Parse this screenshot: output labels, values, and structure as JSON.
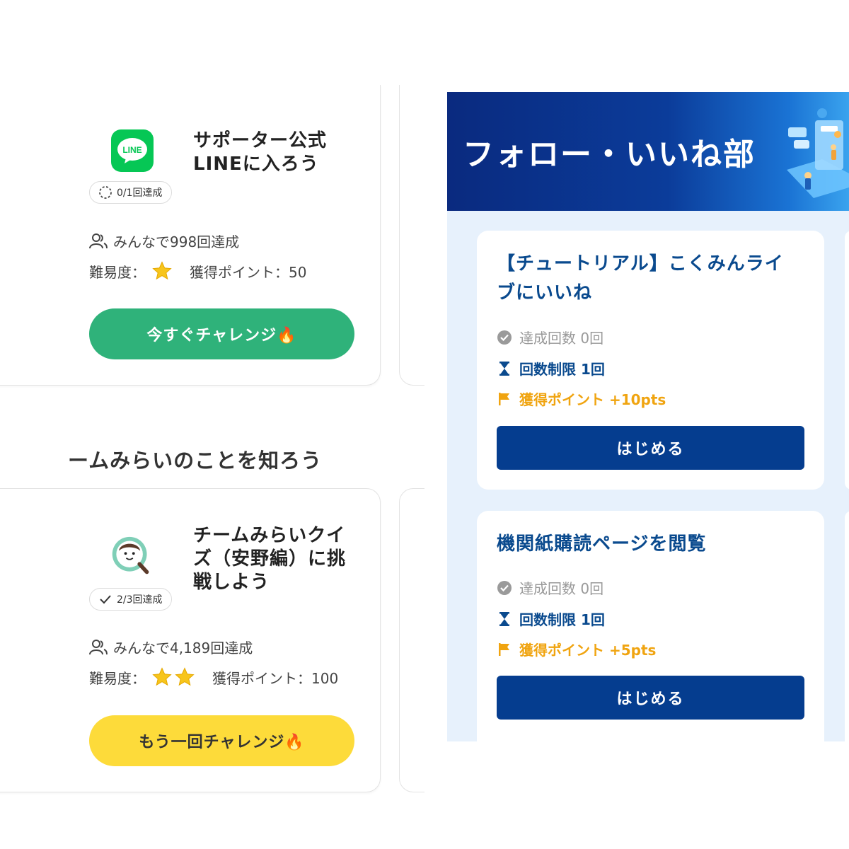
{
  "left": {
    "mission1": {
      "icon_text": "LINE",
      "title_line1": "サポーター公式",
      "title_line2": "LINEに入ろう",
      "progress": "0/1回達成",
      "everyone": "みんなで998回達成",
      "difficulty_label": "難易度：",
      "difficulty_stars": 1,
      "points": "獲得ポイント：50",
      "cta": "今すぐチャレンジ🔥",
      "cta_color": "#2fb27a"
    },
    "section_title": "ームみらいのことを知ろう",
    "mission2": {
      "title_line1": "チームみらいクイ",
      "title_line2": "ズ（安野編）に挑",
      "title_line3": "戦しよう",
      "progress": "2/3回達成",
      "everyone": "みんなで4,189回達成",
      "difficulty_label": "難易度：",
      "difficulty_stars": 2,
      "points": "獲得ポイント：100",
      "cta": "もう一回チャレンジ🔥",
      "cta_color": "#fddb3a"
    }
  },
  "right": {
    "banner_title": "フォロー・いいね部",
    "cards": [
      {
        "title_line1": "【チュートリアル】こくみんライ",
        "title_line2": "ブにいいね",
        "achieved": "達成回数 0回",
        "limit": "回数制限 1回",
        "points": "獲得ポイント +10pts",
        "button": "はじめる"
      },
      {
        "title_line1": "機関紙購読ページを閲覧",
        "achieved": "達成回数 0回",
        "limit": "回数制限 1回",
        "points": "獲得ポイント +5pts",
        "button": "はじめる"
      }
    ],
    "colors": {
      "title": "#0a4a8e",
      "points": "#f0a410",
      "button": "#053d8f",
      "muted": "#999999"
    }
  }
}
